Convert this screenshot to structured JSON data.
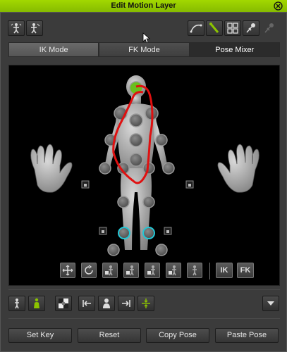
{
  "window": {
    "title": "Edit Motion Layer"
  },
  "tabs": [
    {
      "label": "IK Mode",
      "active": false
    },
    {
      "label": "FK Mode",
      "active": true
    },
    {
      "label": "Pose Mixer",
      "active": false
    }
  ],
  "stage_buttons": {
    "ik_label": "IK",
    "fk_label": "FK"
  },
  "actions": {
    "set_key": "Set Key",
    "reset": "Reset",
    "copy_pose": "Copy Pose",
    "paste_pose": "Paste Pose"
  },
  "colors": {
    "accent": "#8cc400",
    "selected_joint": "#6abf1e",
    "highlight_ring": "#22c7d6",
    "annotation": "#e01010"
  },
  "icons": {
    "toolbar_left": [
      "mirror-pose-icon",
      "flip-pose-icon"
    ],
    "toolbar_right": [
      "curve-icon",
      "bone-select-icon",
      "grid-select-icon",
      "pin-icon",
      "pin-disabled-icon"
    ],
    "stage_bottom": [
      "move-icon",
      "rotate-icon",
      "lock-figure-icon",
      "lock-figure-icon",
      "lock-figure-icon",
      "lock-figure-icon",
      "figure-icon"
    ],
    "bottom_toolbar": [
      "figure-icon",
      "figure-selected-icon",
      "checker-icon",
      "step-back-icon",
      "person-icon",
      "step-forward-icon",
      "expand-icon",
      "dropdown-arrow-icon"
    ]
  }
}
